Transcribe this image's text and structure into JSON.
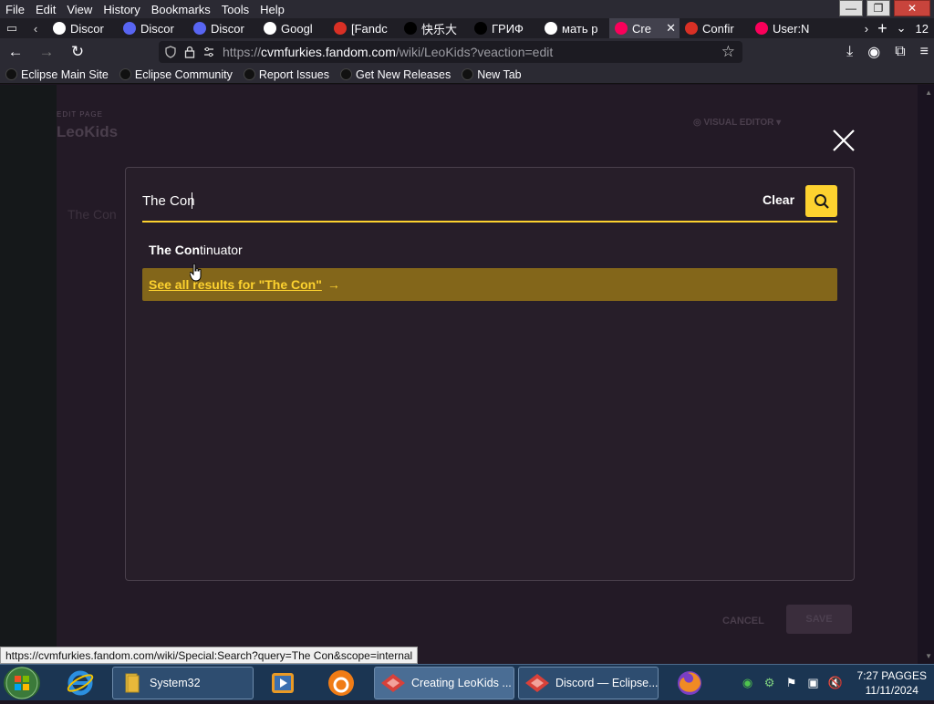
{
  "menu": {
    "items": [
      "File",
      "Edit",
      "View",
      "History",
      "Bookmarks",
      "Tools",
      "Help"
    ],
    "underline": [
      "F",
      "E",
      "V",
      "H",
      "B",
      "T",
      "H"
    ]
  },
  "tabs": [
    {
      "label": "Discor",
      "icon": "discord-icon",
      "color": "#ffffff"
    },
    {
      "label": "Discor",
      "icon": "discord-icon",
      "color": "#5865f2"
    },
    {
      "label": "Discor",
      "icon": "discord-icon",
      "color": "#5865f2"
    },
    {
      "label": "Googl",
      "icon": "google-icon",
      "color": "#ffffff"
    },
    {
      "label": "[Fandc",
      "icon": "gmail-icon",
      "color": "#d93025"
    },
    {
      "label": "快乐大",
      "icon": "cat-icon",
      "color": "#000000"
    },
    {
      "label": "ГРИФ",
      "icon": "youtube-icon",
      "color": "#000000"
    },
    {
      "label": "мать р",
      "icon": "google-icon",
      "color": "#ffffff"
    },
    {
      "label": "Cre",
      "icon": "fandom-icon",
      "color": "#fa005a",
      "active": true
    },
    {
      "label": "Confir",
      "icon": "gmail-icon",
      "color": "#d93025"
    },
    {
      "label": "User:N",
      "icon": "fandom-icon",
      "color": "#fa005a"
    }
  ],
  "tab_overflow_count": "12",
  "address": {
    "prefix": "https://",
    "host": "cvmfurkies.fandom.com",
    "path": "/wiki/LeoKids?veaction=edit"
  },
  "bookmarks": [
    {
      "label": "Eclipse Main Site",
      "icon": "eclipse-icon"
    },
    {
      "label": "Eclipse Community",
      "icon": "eclipse-icon"
    },
    {
      "label": "Report Issues",
      "icon": "github-icon"
    },
    {
      "label": "Get New Releases",
      "icon": "github-icon"
    },
    {
      "label": "New Tab",
      "icon": "globe-icon"
    }
  ],
  "editor_bg": {
    "label": "EDIT PAGE",
    "title": "LeoKids",
    "visual_editing": "VISUAL EDITOR",
    "row_text": "The Con",
    "cancel": "CANCEL",
    "save": "SAVE"
  },
  "search": {
    "value": "The Con",
    "clear_label": "Clear",
    "suggestion_match": "The Con",
    "suggestion_rest": "tinuator",
    "see_all_label": "See all results for \"The Con\"",
    "see_all_arrow": "→"
  },
  "status_url": "https://cvmfurkies.fandom.com/wiki/Special:Search?query=The Con&scope=internal",
  "taskbar": {
    "tasks": [
      {
        "label": "System32",
        "icon": "folder-icon"
      },
      {
        "label": "Creating LeoKids ...",
        "icon": "eclipse-browser-icon",
        "active": true
      },
      {
        "label": "Discord — Eclipse...",
        "icon": "eclipse-browser-icon"
      }
    ],
    "clock_time": "7:27 PAGGES",
    "clock_date": "11/11/2024"
  },
  "colors": {
    "accent": "#fdd22f",
    "see_all_bg": "#83661a"
  }
}
